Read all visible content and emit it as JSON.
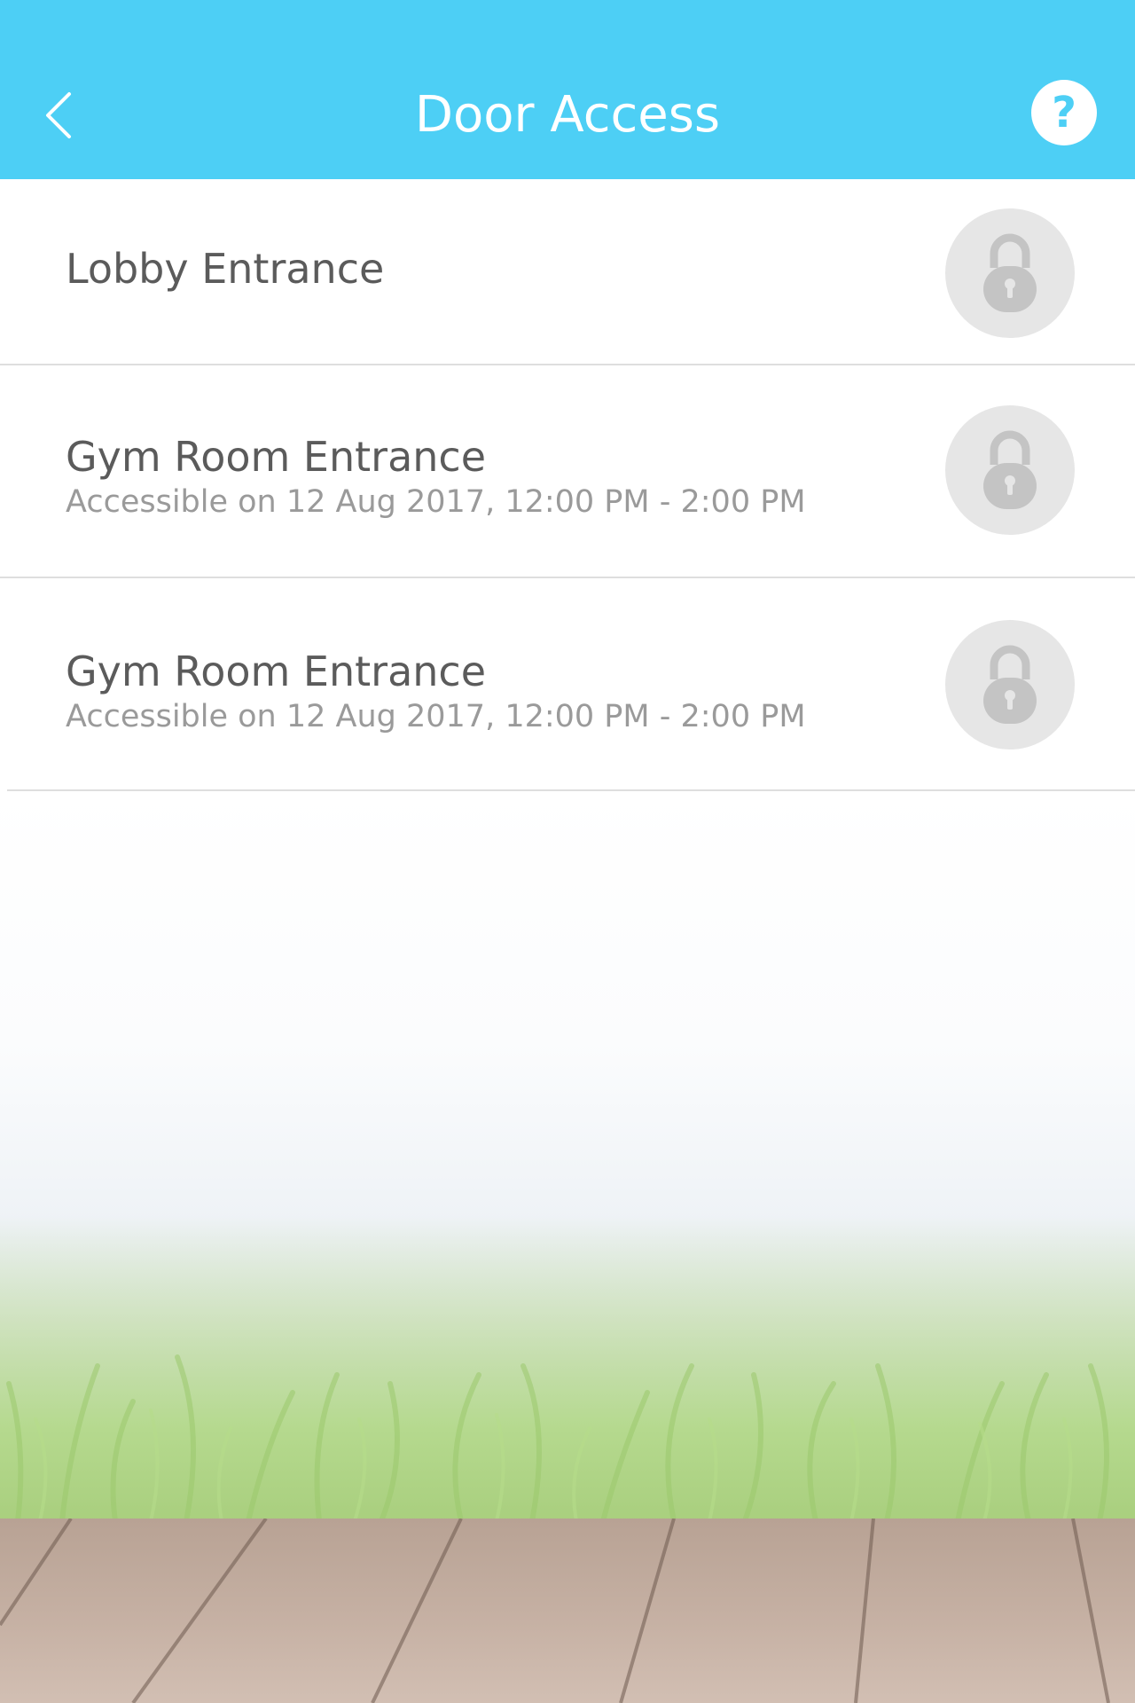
{
  "header": {
    "title": "Door Access",
    "back_icon": "chevron-left-icon",
    "help_label": "?"
  },
  "doors": [
    {
      "name": "Lobby Entrance",
      "schedule": "",
      "lock_icon": "padlock-icon"
    },
    {
      "name": "Gym Room Entrance",
      "schedule": "Accessible on 12 Aug 2017, 12:00 PM - 2:00 PM",
      "lock_icon": "padlock-icon"
    },
    {
      "name": "Gym Room Entrance",
      "schedule": "Accessible on 12 Aug 2017, 12:00 PM - 2:00 PM",
      "lock_icon": "padlock-icon"
    }
  ],
  "colors": {
    "header_bg": "#4dcff5",
    "title_text": "#ffffff",
    "row_title": "#5b5b5b",
    "row_subtitle": "#9a9a9a",
    "lock_bg": "#e6e6e6",
    "lock_icon": "#c4c4c4"
  }
}
